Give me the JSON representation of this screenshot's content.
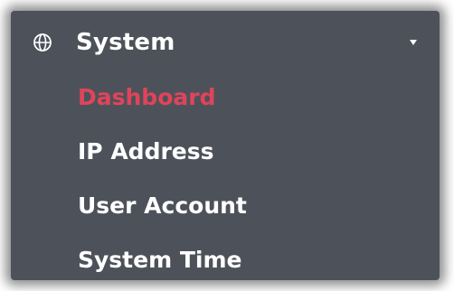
{
  "menu": {
    "header": {
      "label": "System",
      "icon": "globe-icon",
      "caret_icon": "caret-down-icon",
      "expanded": true
    },
    "items": [
      {
        "label": "Dashboard",
        "active": true
      },
      {
        "label": "IP Address",
        "active": false
      },
      {
        "label": "User Account",
        "active": false
      },
      {
        "label": "System Time",
        "active": false
      }
    ]
  },
  "colors": {
    "panel_bg": "#4d525a",
    "text": "#ffffff",
    "active_text": "#e0445a"
  }
}
